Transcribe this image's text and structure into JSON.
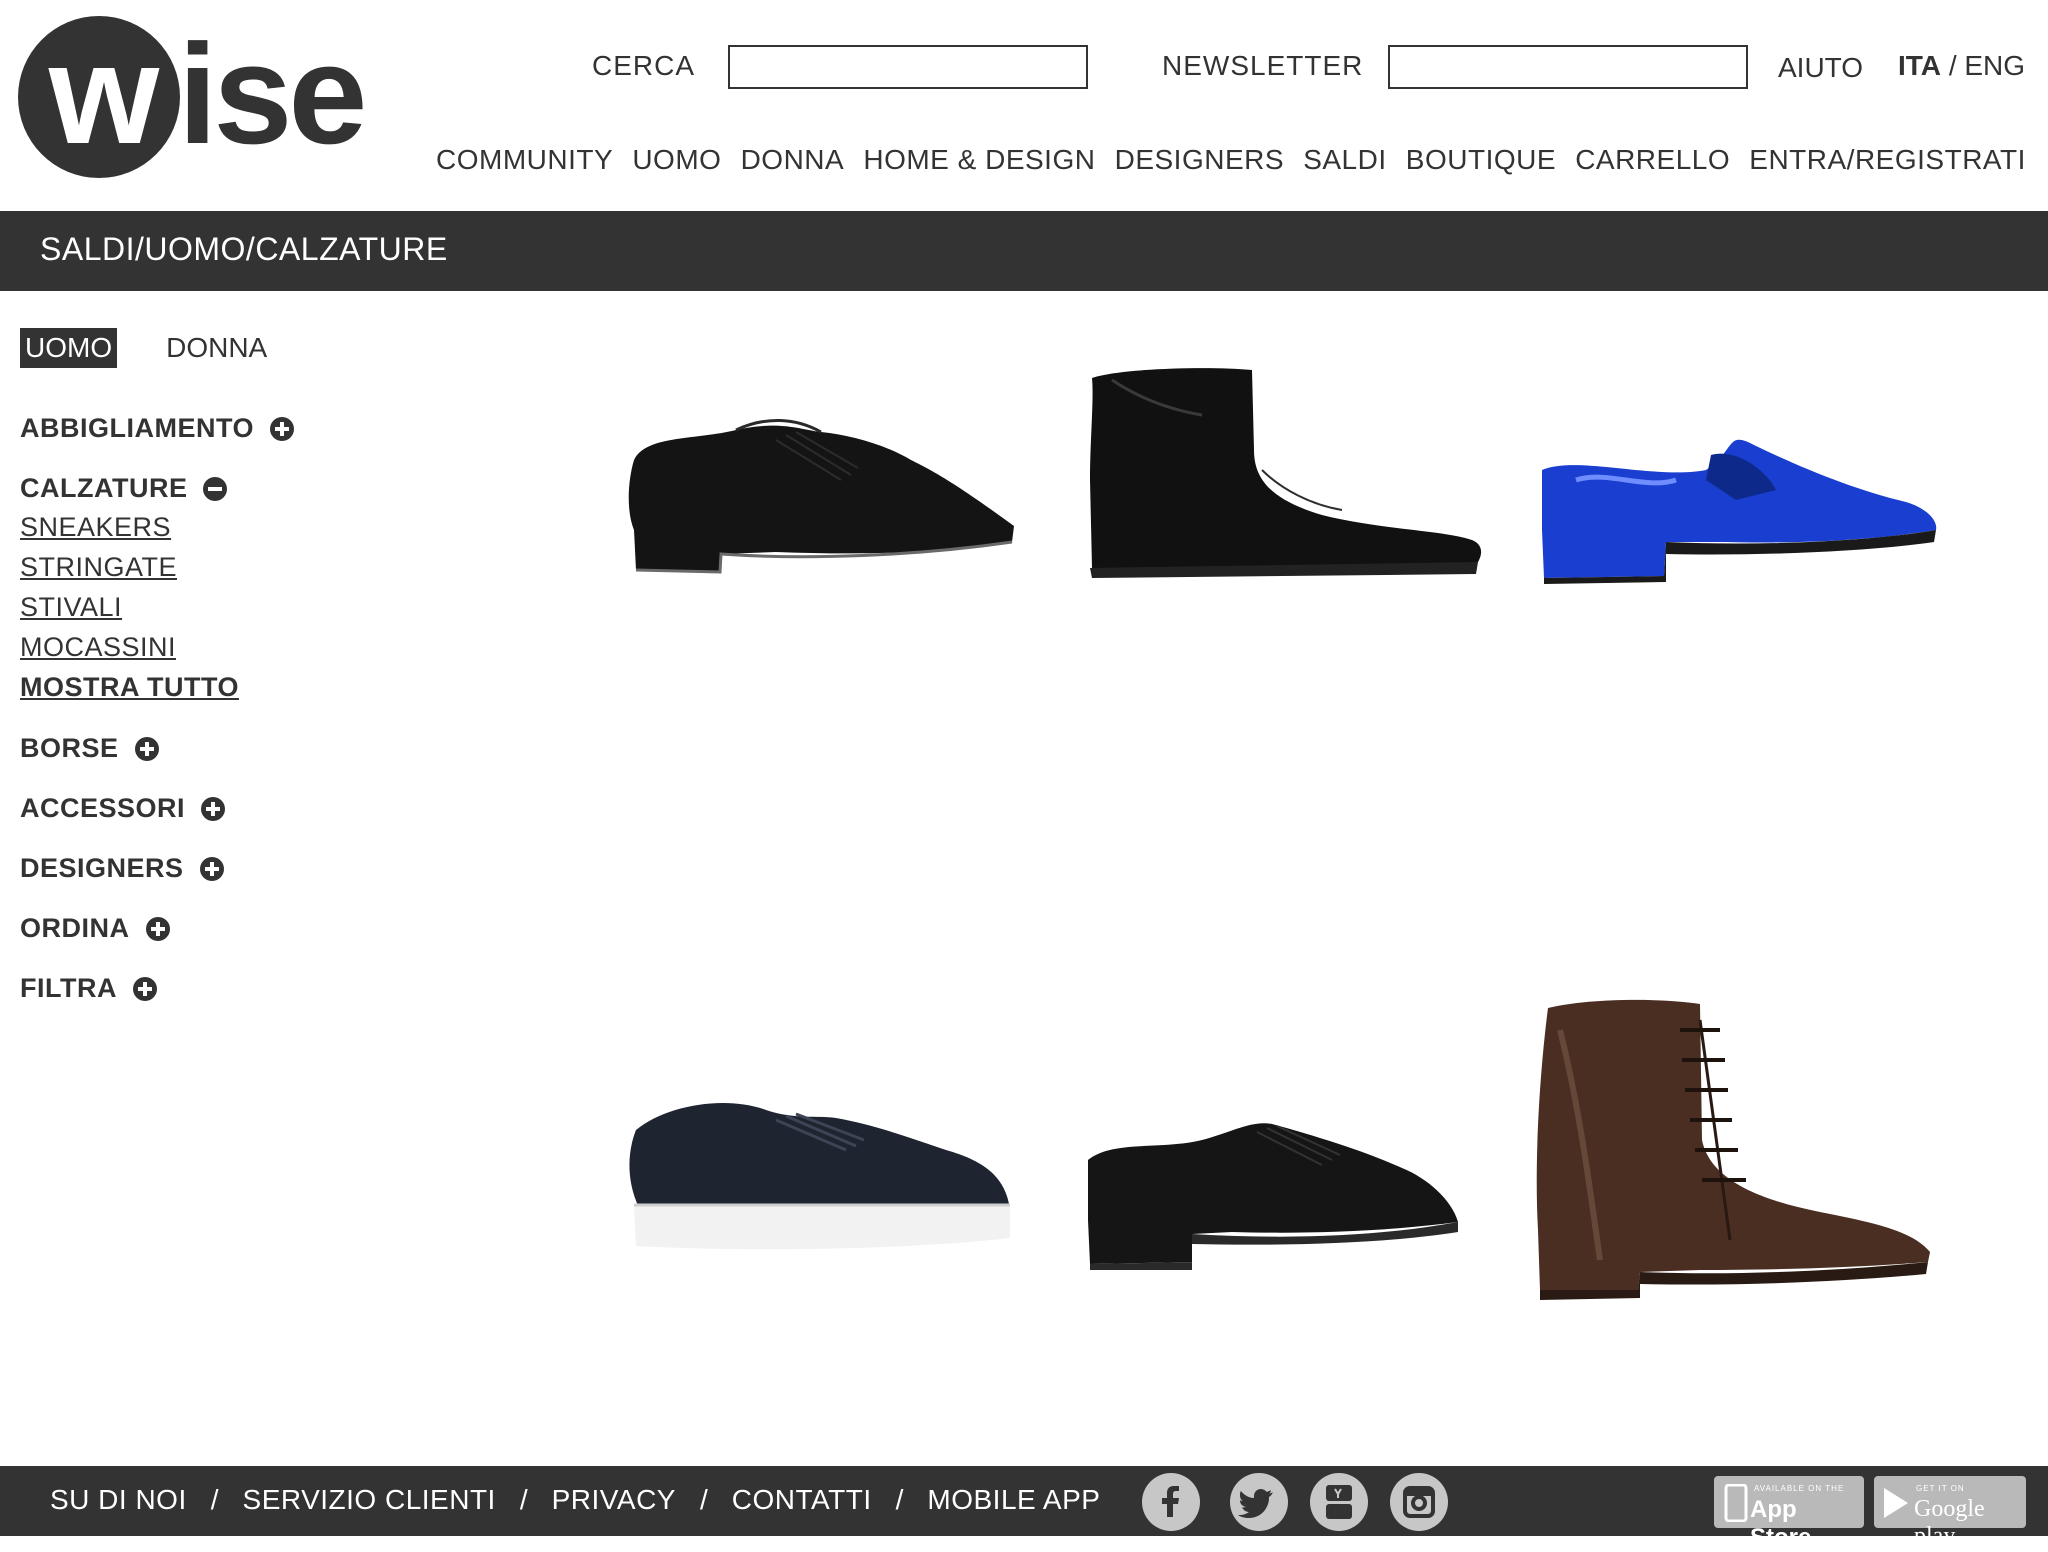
{
  "brand": {
    "logo_w": "w",
    "logo_rest": "ise"
  },
  "header": {
    "search_label": "CERCA",
    "search_value": "",
    "newsletter_label": "NEWSLETTER",
    "newsletter_value": "",
    "help": "AIUTO",
    "lang_active": "ITA",
    "lang_sep": "/",
    "lang_other": "ENG"
  },
  "nav": {
    "community": "COMMUNITY",
    "uomo": "UOMO",
    "donna": "DONNA",
    "home_design": "HOME & DESIGN",
    "designers": "DESIGNERS",
    "saldi": "SALDI",
    "boutique": "BOUTIQUE",
    "carrello": "CARRELLO",
    "login": "ENTRA/REGISTRATI"
  },
  "breadcrumb": "SALDI/UOMO/CALZATURE",
  "sidebar": {
    "gender_uomo": "UOMO",
    "gender_donna": "DONNA",
    "abbigliamento": "ABBIGLIAMENTO",
    "calzature": "CALZATURE",
    "calzature_sub": [
      "SNEAKERS",
      "STRINGATE",
      "STIVALI",
      "MOCASSINI"
    ],
    "mostra_tutto": "MOSTRA TUTTO",
    "borse": "BORSE",
    "accessori": "ACCESSORI",
    "designers": "DESIGNERS",
    "ordina": "ORDINA",
    "filtra": "FILTRA"
  },
  "products": [
    {
      "kind": "suede-brogue-oxford",
      "color": "#141414"
    },
    {
      "kind": "leather-ankle-boot",
      "color": "#111111"
    },
    {
      "kind": "metallic-blue-loafer",
      "color": "#1a3fd0"
    },
    {
      "kind": "leather-sneaker",
      "color": "#1e2430"
    },
    {
      "kind": "leather-brogue-derby",
      "color": "#151515"
    },
    {
      "kind": "lace-up-brown-boot",
      "color": "#4a2e22"
    }
  ],
  "footer": {
    "about": "SU DI NOI",
    "service": "SERVIZIO CLIENTI",
    "privacy": "PRIVACY",
    "contacts": "CONTATTI",
    "mobile": "MOBILE APP",
    "sep": "/",
    "social_icons": [
      "facebook-icon",
      "twitter-icon",
      "youtube-icon",
      "instagram-icon"
    ],
    "appstore_small": "AVAILABLE ON THE",
    "appstore_big": "App Store",
    "googleplay_small": "GET IT ON",
    "googleplay_big": "Google play"
  }
}
